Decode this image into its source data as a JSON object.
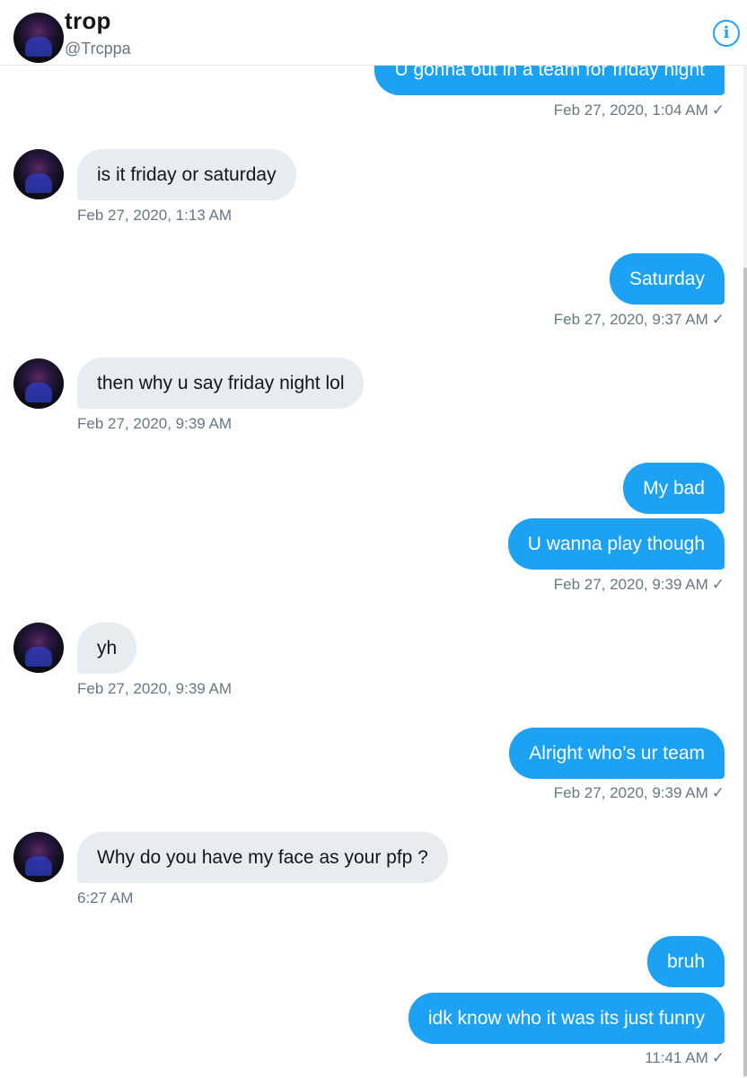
{
  "header": {
    "name": "trop",
    "handle": "@Trcppa",
    "info_icon": "info-icon",
    "info_glyph": "i"
  },
  "messages": [
    {
      "from": "me",
      "text": "U gonna out in a team for friday night",
      "time": "Feb 27, 2020, 1:04 AM"
    },
    {
      "from": "them",
      "text": "is it friday or saturday",
      "time": "Feb 27, 2020, 1:13 AM"
    },
    {
      "from": "me",
      "text": "Saturday",
      "time": "Feb 27, 2020, 9:37 AM"
    },
    {
      "from": "them",
      "text": "then why u say friday night lol",
      "time": "Feb 27, 2020, 9:39 AM"
    },
    {
      "from": "me",
      "text": "My bad"
    },
    {
      "from": "me",
      "text": "U wanna play though",
      "time": "Feb 27, 2020, 9:39 AM"
    },
    {
      "from": "them",
      "text": "yh",
      "time": "Feb 27, 2020, 9:39 AM"
    },
    {
      "from": "me",
      "text": "Alright who’s ur team",
      "time": "Feb 27, 2020, 9:39 AM"
    },
    {
      "from": "them",
      "text": "Why do you have my face as your pfp ?",
      "time": "6:27 AM"
    },
    {
      "from": "me",
      "text": "bruh"
    },
    {
      "from": "me",
      "text": "idk know who it was its just funny",
      "time": "11:41 AM"
    }
  ],
  "read_receipt": "✓",
  "colors": {
    "sent_bubble": "#1da1f2",
    "received_bubble": "#e6ecf0",
    "timestamp": "#657786"
  }
}
